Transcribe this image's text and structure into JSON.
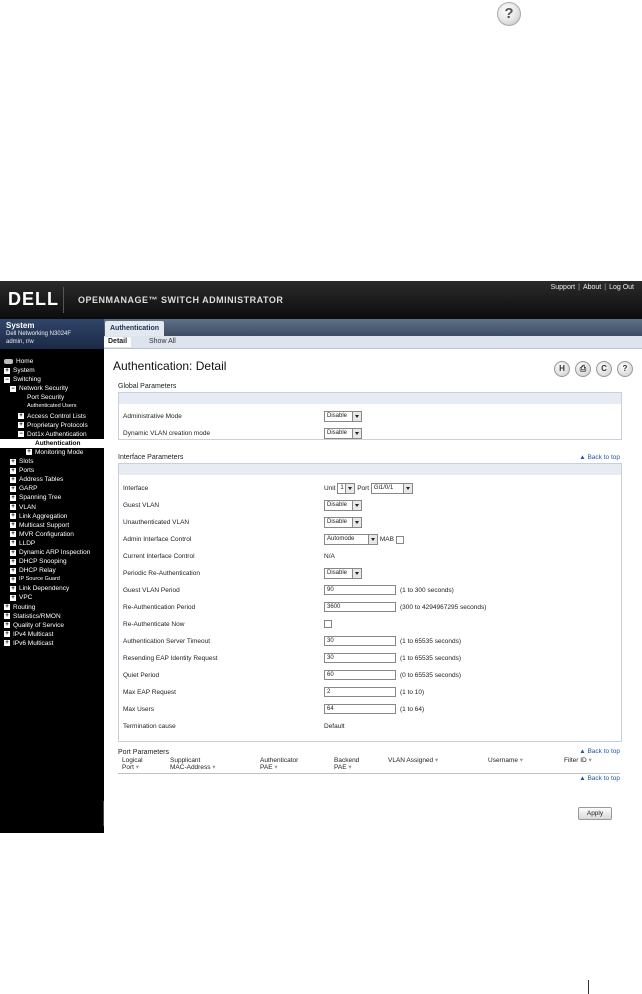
{
  "header": {
    "logo": "DELL",
    "title": "OPENMANAGE™ SWITCH ADMINISTRATOR",
    "links": [
      "Support",
      "About",
      "Log Out"
    ],
    "help_glyph": "?"
  },
  "sidebar": {
    "system_title": "System",
    "device": "Dell Networking N3024F",
    "user": "admin, r/w",
    "tree": [
      {
        "label": "Home",
        "indent": 0,
        "box": "home"
      },
      {
        "label": "System",
        "indent": 0,
        "box": "+"
      },
      {
        "label": "Switching",
        "indent": 0,
        "box": "−"
      },
      {
        "label": "Network Security",
        "indent": 1,
        "box": "−"
      },
      {
        "label": "Port Security",
        "indent": 2,
        "box": ""
      },
      {
        "label": "Authenticated Users",
        "indent": 2,
        "box": "",
        "small": true
      },
      {
        "label": "Access Control Lists",
        "indent": 2,
        "box": "+"
      },
      {
        "label": "Proprietary Protocols",
        "indent": 2,
        "box": "+"
      },
      {
        "label": "Dot1x Authentication",
        "indent": 2,
        "box": "−"
      },
      {
        "label": "Authentication",
        "indent": 3,
        "box": "",
        "selected": true
      },
      {
        "label": "Monitoring Mode",
        "indent": 3,
        "box": "+"
      },
      {
        "label": "Slots",
        "indent": 1,
        "box": "+"
      },
      {
        "label": "Ports",
        "indent": 1,
        "box": "+"
      },
      {
        "label": "Address Tables",
        "indent": 1,
        "box": "+"
      },
      {
        "label": "GARP",
        "indent": 1,
        "box": "+"
      },
      {
        "label": "Spanning Tree",
        "indent": 1,
        "box": "+"
      },
      {
        "label": "VLAN",
        "indent": 1,
        "box": "+"
      },
      {
        "label": "Link Aggregation",
        "indent": 1,
        "box": "+"
      },
      {
        "label": "Multicast Support",
        "indent": 1,
        "box": "+"
      },
      {
        "label": "MVR Configuration",
        "indent": 1,
        "box": "+"
      },
      {
        "label": "LLDP",
        "indent": 1,
        "box": "+"
      },
      {
        "label": "Dynamic ARP Inspection",
        "indent": 1,
        "box": "+"
      },
      {
        "label": "DHCP Snooping",
        "indent": 1,
        "box": "+"
      },
      {
        "label": "DHCP Relay",
        "indent": 1,
        "box": "+"
      },
      {
        "label": "IP Source Guard",
        "indent": 1,
        "box": "+",
        "small": true
      },
      {
        "label": "Link Dependency",
        "indent": 1,
        "box": "+"
      },
      {
        "label": "VPC",
        "indent": 1,
        "box": "+"
      },
      {
        "label": "Routing",
        "indent": 0,
        "box": "+"
      },
      {
        "label": "Statistics/RMON",
        "indent": 0,
        "box": "+"
      },
      {
        "label": "Quality of Service",
        "indent": 0,
        "box": "+"
      },
      {
        "label": "IPv4 Multicast",
        "indent": 0,
        "box": "+"
      },
      {
        "label": "IPv6 Multicast",
        "indent": 0,
        "box": "+"
      }
    ]
  },
  "main": {
    "tab": "Authentication",
    "subtabs": [
      "Detail",
      "Show All"
    ],
    "page_title": "Authentication: Detail",
    "toolbar_icons": [
      {
        "name": "save-icon",
        "glyph": "H"
      },
      {
        "name": "print-icon",
        "glyph": "⎙"
      },
      {
        "name": "refresh-icon",
        "glyph": "C"
      },
      {
        "name": "help-icon",
        "glyph": "?"
      }
    ],
    "back_to_top": "▲ Back to top",
    "global": {
      "heading": "Global Parameters",
      "admin_mode_label": "Administrative Mode",
      "admin_mode_value": "Disable",
      "dyn_vlan_label": "Dynamic VLAN creation mode",
      "dyn_vlan_value": "Disable"
    },
    "interface": {
      "heading": "Interface Parameters",
      "interface_label": "Interface",
      "unit_label": "Unit",
      "unit_value": "1",
      "port_label": "Port",
      "port_value": "Gi1/0/1",
      "guest_vlan_label": "Guest VLAN",
      "guest_vlan_value": "Disable",
      "unauth_vlan_label": "Unauthenticated VLAN",
      "unauth_vlan_value": "Disable",
      "admin_ctrl_label": "Admin Interface Control",
      "admin_ctrl_value": "Automode",
      "mab_label": "MAB",
      "current_ctrl_label": "Current Interface Control",
      "current_ctrl_value": "N/A",
      "periodic_label": "Periodic Re-Authentication",
      "periodic_value": "Disable",
      "guest_period_label": "Guest VLAN Period",
      "guest_period_value": "90",
      "guest_period_hint": "(1 to 300 seconds)",
      "reauth_period_label": "Re-Authentication Period",
      "reauth_period_value": "3600",
      "reauth_period_hint": "(300 to 4294967295 seconds)",
      "reauth_now_label": "Re-Authenticate Now",
      "server_timeout_label": "Authentication Server Timeout",
      "server_timeout_value": "30",
      "server_timeout_hint": "(1 to 65535 seconds)",
      "resend_label": "Resending EAP Identity Request",
      "resend_value": "30",
      "resend_hint": "(1 to 65535 seconds)",
      "quiet_label": "Quiet Period",
      "quiet_value": "60",
      "quiet_hint": "(0 to 65535 seconds)",
      "max_eap_label": "Max EAP Request",
      "max_eap_value": "2",
      "max_eap_hint": "(1 to 10)",
      "max_users_label": "Max Users",
      "max_users_value": "64",
      "max_users_hint": "(1 to 64)",
      "term_label": "Termination cause",
      "term_value": "Default"
    },
    "port_params": {
      "heading": "Port Parameters",
      "columns": [
        {
          "l1": "Logical",
          "l2": "Port"
        },
        {
          "l1": "Supplicant",
          "l2": "MAC-Address"
        },
        {
          "l1": "Authenticator",
          "l2": "PAE"
        },
        {
          "l1": "Backend",
          "l2": "PAE"
        },
        {
          "l1": "",
          "l2": "VLAN Assigned"
        },
        {
          "l1": "",
          "l2": "Username"
        },
        {
          "l1": "",
          "l2": "Filter ID"
        }
      ]
    },
    "apply_label": "Apply"
  }
}
